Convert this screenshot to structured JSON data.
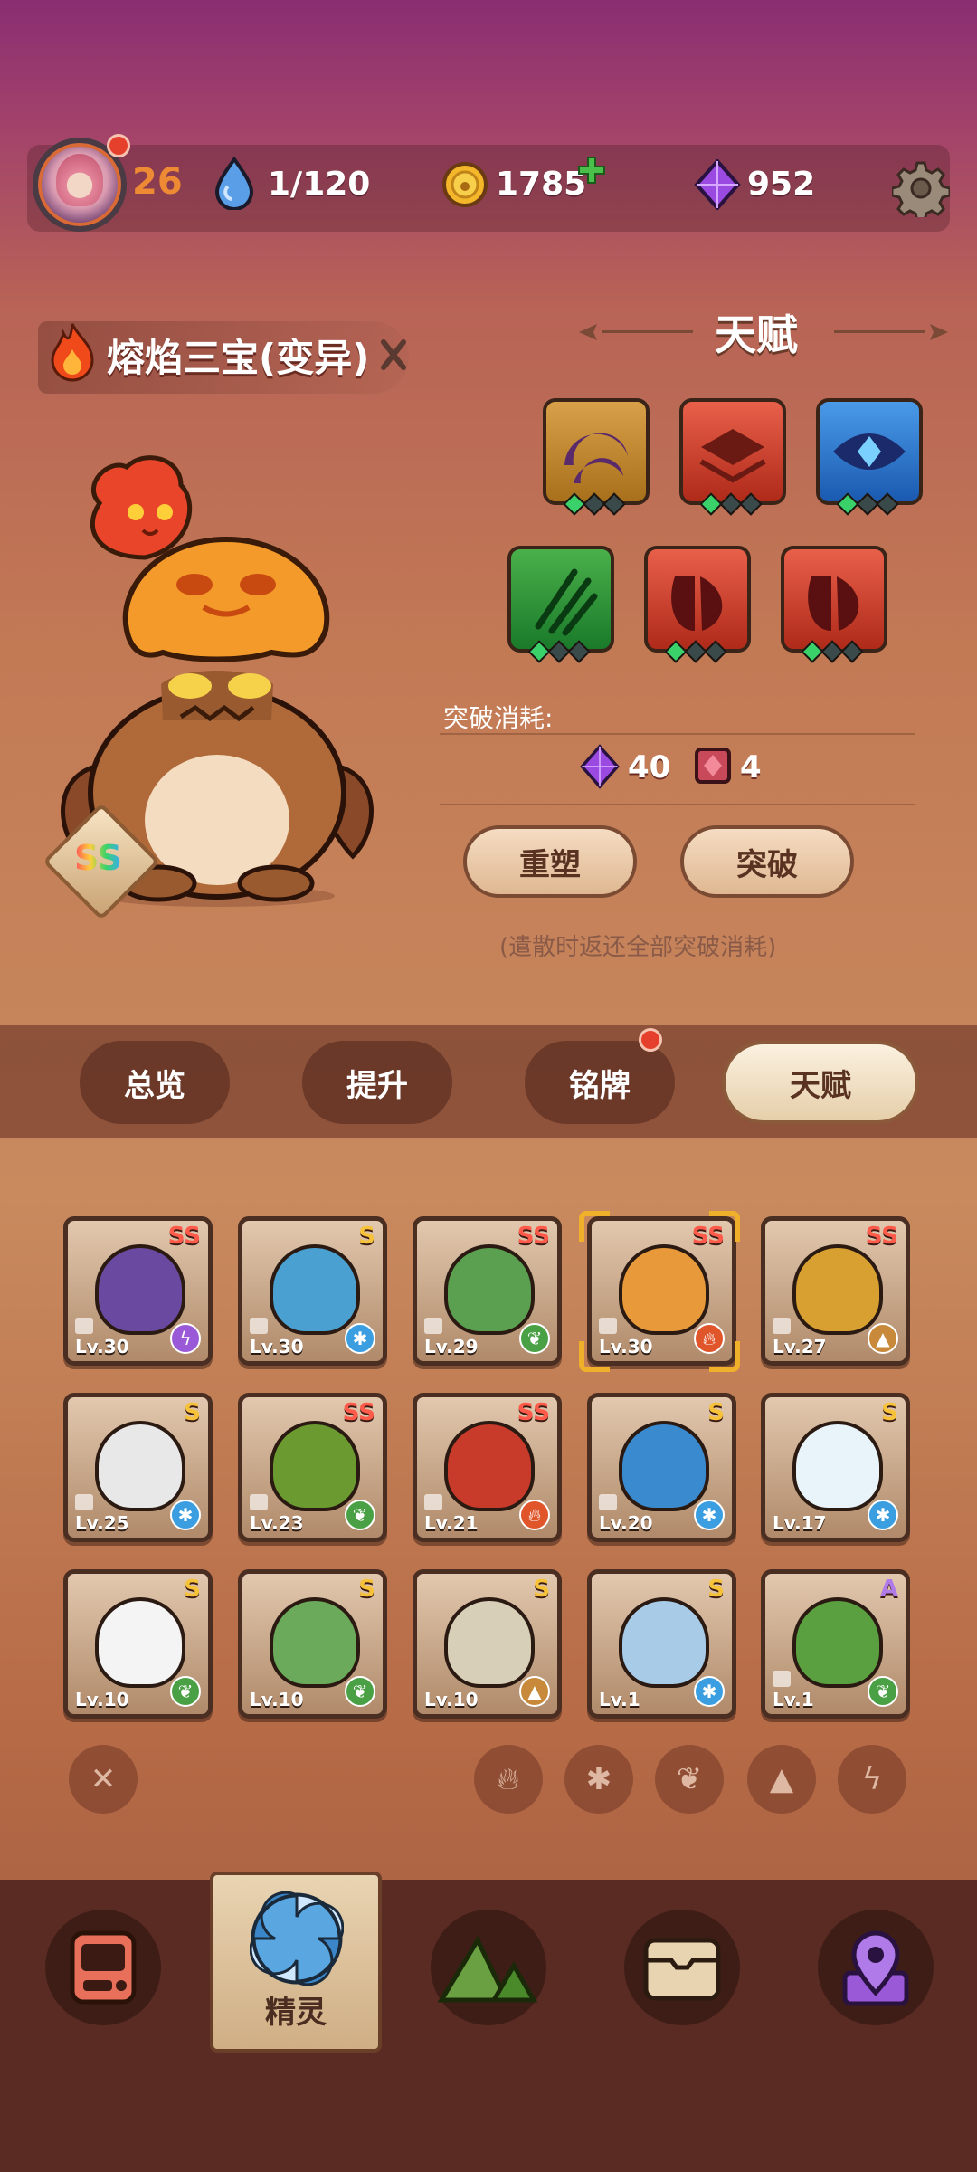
{
  "colors": {
    "fire": "#e0552a",
    "water": "#3a9ee0",
    "grass": "#4aa044",
    "earth": "#c88a3a",
    "electric": "#9a5ad8",
    "accent_orange": "#ef8a34"
  },
  "topbar": {
    "player_level": "26",
    "stamina": "1/120",
    "coins": "1785",
    "gems": "952",
    "icons": [
      "avatar",
      "water-drop-icon",
      "coin-icon",
      "plus-icon",
      "gem-icon",
      "gear-icon"
    ]
  },
  "creature": {
    "name": "熔焰三宝(变异)",
    "rank": "SS",
    "element_icon": "fire-icon"
  },
  "talent": {
    "title": "天赋",
    "icons": [
      {
        "name": "crescent-talent-icon",
        "color": "#c98a2a",
        "filled": 1
      },
      {
        "name": "layers-talent-icon",
        "color": "#d9483a",
        "filled": 1
      },
      {
        "name": "eye-talent-icon",
        "color": "#3a7ad8",
        "filled": 1
      },
      {
        "name": "claw-talent-icon",
        "color": "#3a9a3a",
        "filled": 1
      },
      {
        "name": "drop-talent-icon",
        "color": "#d9483a",
        "filled": 1
      },
      {
        "name": "drop-talent-icon",
        "color": "#d9483a",
        "filled": 1
      }
    ],
    "cost_label": "突破消耗:",
    "cost_gems": "40",
    "cost_items": "4",
    "reshape_button": "重塑",
    "breakthrough_button": "突破",
    "note": "(遣散时返还全部突破消耗)"
  },
  "tabs": {
    "overview": "总览",
    "upgrade": "提升",
    "badge": "铭牌",
    "talent": "天赋"
  },
  "creatures": [
    {
      "rank": "SS",
      "level": "Lv.30",
      "element": "electric",
      "locked": true,
      "color": "#6a4aa0"
    },
    {
      "rank": "S",
      "level": "Lv.30",
      "element": "water",
      "locked": true,
      "color": "#4aa0d0"
    },
    {
      "rank": "SS",
      "level": "Lv.29",
      "element": "grass",
      "locked": true,
      "color": "#5aa050"
    },
    {
      "rank": "SS",
      "level": "Lv.30",
      "element": "fire",
      "locked": true,
      "color": "#e89a3a"
    },
    {
      "rank": "SS",
      "level": "Lv.27",
      "element": "earth",
      "locked": true,
      "color": "#d8a030"
    },
    {
      "rank": "S",
      "level": "Lv.25",
      "element": "water",
      "locked": true,
      "color": "#e8e8e8"
    },
    {
      "rank": "SS",
      "level": "Lv.23",
      "element": "grass",
      "locked": true,
      "color": "#6a9a30"
    },
    {
      "rank": "SS",
      "level": "Lv.21",
      "element": "fire",
      "locked": true,
      "color": "#c83a2a"
    },
    {
      "rank": "S",
      "level": "Lv.20",
      "element": "water",
      "locked": true,
      "color": "#3a8ad0"
    },
    {
      "rank": "S",
      "level": "Lv.17",
      "element": "water",
      "locked": false,
      "color": "#e8f4fa"
    },
    {
      "rank": "S",
      "level": "Lv.10",
      "element": "grass",
      "locked": false,
      "color": "#f4f4f4"
    },
    {
      "rank": "S",
      "level": "Lv.10",
      "element": "grass",
      "locked": false,
      "color": "#6aaa5a"
    },
    {
      "rank": "S",
      "level": "Lv.10",
      "element": "earth",
      "locked": false,
      "color": "#d8cfb8"
    },
    {
      "rank": "S",
      "level": "Lv.1",
      "element": "water",
      "locked": false,
      "color": "#a8cce8"
    },
    {
      "rank": "A",
      "level": "Lv.1",
      "element": "grass",
      "locked": true,
      "color": "#5aa040"
    }
  ],
  "filters": [
    "clear-filter-icon",
    "fire-filter-icon",
    "water-filter-icon",
    "grass-filter-icon",
    "earth-filter-icon",
    "electric-filter-icon"
  ],
  "bottom_nav": {
    "active_label": "精灵",
    "items": [
      "device-icon",
      "spirit-icon",
      "mountain-icon",
      "chest-icon",
      "map-pin-icon"
    ]
  }
}
